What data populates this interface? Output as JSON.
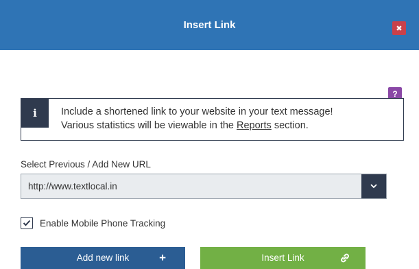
{
  "header": {
    "title": "Insert Link",
    "close_icon": "close-icon"
  },
  "help": {
    "label": "?"
  },
  "info": {
    "icon_glyph": "i",
    "text_line1": "Include a shortened link to your website in your text message!",
    "text_line2_before": "Various statistics will be viewable in the ",
    "link_text": "Reports",
    "text_line2_after": " section."
  },
  "url": {
    "label": "Select Previous / Add New URL",
    "value": "http://www.textlocal.in",
    "chevron_icon": "chevron-down-icon"
  },
  "tracking": {
    "label": "Enable Mobile Phone Tracking",
    "checked": true
  },
  "buttons": {
    "add_label": "Add new link",
    "add_icon": "plus-icon",
    "insert_label": "Insert Link",
    "insert_icon": "link-icon"
  },
  "colors": {
    "header": "#2f74b5",
    "close": "#c9414b",
    "help": "#8a48a6",
    "info_dark": "#2f3a4e",
    "add_button": "#2b5d93",
    "insert_button": "#72b045"
  }
}
